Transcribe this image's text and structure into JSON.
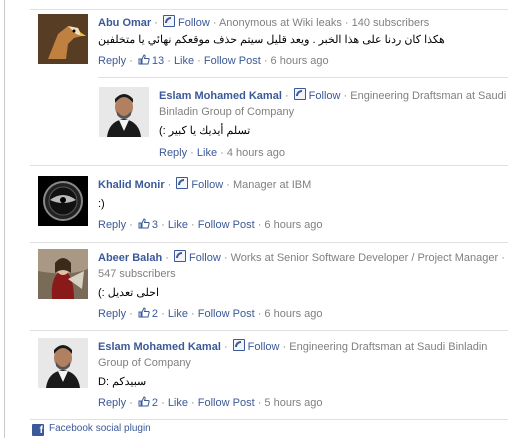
{
  "comments": [
    {
      "name": "Abu Omar",
      "follow": "Follow",
      "meta": "Anonymous at Wiki leaks · 140 subscribers",
      "text": "هكذا كان ردنا على هذا الخبر . ويعد قليل سيتم حذف موقعكم نهائي يا متخلفين",
      "actions": {
        "reply": "Reply",
        "likes": "13",
        "like": "Like",
        "follow_post": "Follow Post",
        "time": "6 hours ago"
      },
      "avatar": "eagle-avatar"
    },
    {
      "name": "Eslam Mohamed Kamal",
      "follow": "Follow",
      "meta": "Engineering Draftsman at Saudi Binladin Group of Company",
      "text": "تسلم أيديك يا كبير :)",
      "actions": {
        "reply": "Reply",
        "like": "Like",
        "time": "4 hours ago"
      },
      "avatar": "man-avatar"
    },
    {
      "name": "Khalid Monir",
      "follow": "Follow",
      "meta": "Manager at IBM",
      "text": ":)",
      "actions": {
        "reply": "Reply",
        "likes": "3",
        "like": "Like",
        "follow_post": "Follow Post",
        "time": "6 hours ago"
      },
      "avatar": "logo-avatar"
    },
    {
      "name": "Abeer Balah",
      "follow": "Follow",
      "meta": "Works at Senior Software Developer / Project Manager · 547 subscribers",
      "text": "احلى تعديل :)",
      "actions": {
        "reply": "Reply",
        "likes": "2",
        "like": "Like",
        "follow_post": "Follow Post",
        "time": "6 hours ago"
      },
      "avatar": "art-avatar"
    },
    {
      "name": "Eslam Mohamed Kamal",
      "follow": "Follow",
      "meta": "Engineering Draftsman at Saudi Binladin Group of Company",
      "text": "سبيدكم :D",
      "actions": {
        "reply": "Reply",
        "likes": "2",
        "like": "Like",
        "follow_post": "Follow Post",
        "time": "5 hours ago"
      },
      "avatar": "man-avatar"
    }
  ],
  "footer": {
    "text": "Facebook social plugin"
  },
  "colors": {
    "link": "#3b5998",
    "meta": "#808080",
    "divider": "#e0e0e0"
  }
}
